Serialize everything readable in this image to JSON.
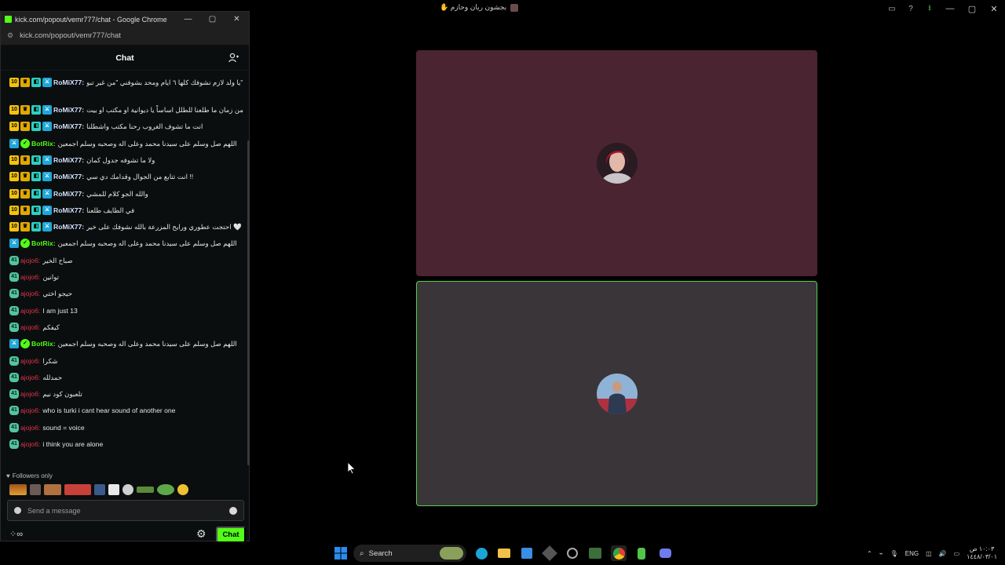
{
  "main_window": {
    "title": "بجشون ريان وحازم ✋",
    "toolbar_icons": [
      "sidebar-icon",
      "help-icon",
      "download-icon"
    ],
    "controls": [
      "minimize",
      "maximize",
      "close"
    ]
  },
  "popout": {
    "window_title": "kick.com/popout/vemr777/chat - Google Chrome",
    "url": "kick.com/popout/vemr777/chat",
    "chat_title": "Chat",
    "messages": [
      {
        "user": "RoMiX77:",
        "badges": [
          "10",
          "crown",
          "og",
          "mod"
        ],
        "text": "يا ولد لازم نشوفك كلها ٦ ايام ومحد بشوفني \"من غير تبو\"",
        "style": "romix"
      },
      {
        "user": "RoMiX77:",
        "badges": [
          "10",
          "crown",
          "og",
          "mod"
        ],
        "text": "من زمان ما طلعنا للطلل اساساً يا ديوانية او مكتب او بيت",
        "style": "romix"
      },
      {
        "user": "RoMiX77:",
        "badges": [
          "10",
          "crown",
          "og",
          "mod"
        ],
        "text": "انت ما تشوف الغروب رحنا مكتب واشطلنا",
        "style": "romix"
      },
      {
        "user": "BotRix:",
        "badges": [
          "mod",
          "verified"
        ],
        "text": "اللهم صل وسلم على سيدنا محمد وعلى اله وصحبه وسلم اجمعين",
        "style": "botrix"
      },
      {
        "user": "RoMiX77:",
        "badges": [
          "10",
          "crown",
          "og",
          "mod"
        ],
        "text": "ولا ما تشوفه جدول كمان",
        "style": "romix"
      },
      {
        "user": "RoMiX77:",
        "badges": [
          "10",
          "crown",
          "og",
          "mod"
        ],
        "text": "انت تتابع من الجوال وقدامك دي سي !!",
        "style": "romix"
      },
      {
        "user": "RoMiX77:",
        "badges": [
          "10",
          "crown",
          "og",
          "mod"
        ],
        "text": "والله الجو كلام للمشي",
        "style": "romix"
      },
      {
        "user": "RoMiX77:",
        "badges": [
          "10",
          "crown",
          "og",
          "mod"
        ],
        "text": "في الطايف طلعنا",
        "style": "romix"
      },
      {
        "user": "RoMiX77:",
        "badges": [
          "10",
          "crown",
          "og",
          "mod"
        ],
        "text": "احتجت عطوري ورايح المزرعة بالله نشوفك على خير 🤍",
        "style": "romix"
      },
      {
        "user": "BotRix:",
        "badges": [
          "mod",
          "verified"
        ],
        "text": "اللهم صل وسلم على سيدنا محمد وعلى اله وصحبه وسلم اجمعين",
        "style": "botrix"
      },
      {
        "user": "ajojo6:",
        "badges": [
          "41"
        ],
        "text": "صباح الخير",
        "style": "ajojo"
      },
      {
        "user": "ajojo6:",
        "badges": [
          "41"
        ],
        "text": "توانين",
        "style": "ajojo"
      },
      {
        "user": "ajojo6:",
        "badges": [
          "41"
        ],
        "text": "حيجو اختي",
        "style": "ajojo"
      },
      {
        "user": "ajojo6:",
        "badges": [
          "41"
        ],
        "text": "I am just 13",
        "style": "ajojo"
      },
      {
        "user": "ajojo6:",
        "badges": [
          "41"
        ],
        "text": "كيفكم",
        "style": "ajojo"
      },
      {
        "user": "BotRix:",
        "badges": [
          "mod",
          "verified"
        ],
        "text": "اللهم صل وسلم على سيدنا محمد وعلى اله وصحبه وسلم اجمعين",
        "style": "botrix"
      },
      {
        "user": "ajojo6:",
        "badges": [
          "41"
        ],
        "text": "شكرا",
        "style": "ajojo"
      },
      {
        "user": "ajojo6:",
        "badges": [
          "41"
        ],
        "text": "حمدلله",
        "style": "ajojo"
      },
      {
        "user": "ajojo6:",
        "badges": [
          "41"
        ],
        "text": "تلعبون كود نيم",
        "style": "ajojo"
      },
      {
        "user": "ajojo6:",
        "badges": [
          "41"
        ],
        "text": "who is turki i cant hear sound of another one",
        "style": "ajojo"
      },
      {
        "user": "ajojo6:",
        "badges": [
          "41"
        ],
        "text": "sound = voice",
        "style": "ajojo"
      },
      {
        "user": "ajojo6:",
        "badges": [
          "41"
        ],
        "text": "i think you are alone",
        "style": "ajojo"
      }
    ],
    "followers_only_label": "Followers only",
    "input_placeholder": "Send a message",
    "chat_button_label": "Chat"
  },
  "taskbar": {
    "search_placeholder": "Search",
    "language": "ENG",
    "time": "١٠:٠٣ ص",
    "date": "١٤٤٨/٠٣/٠١"
  },
  "colors": {
    "kick_green": "#53fc18",
    "tile_top": "#4a2430",
    "tile_bottom": "#3a3538",
    "speaking_border": "#53d14d"
  }
}
